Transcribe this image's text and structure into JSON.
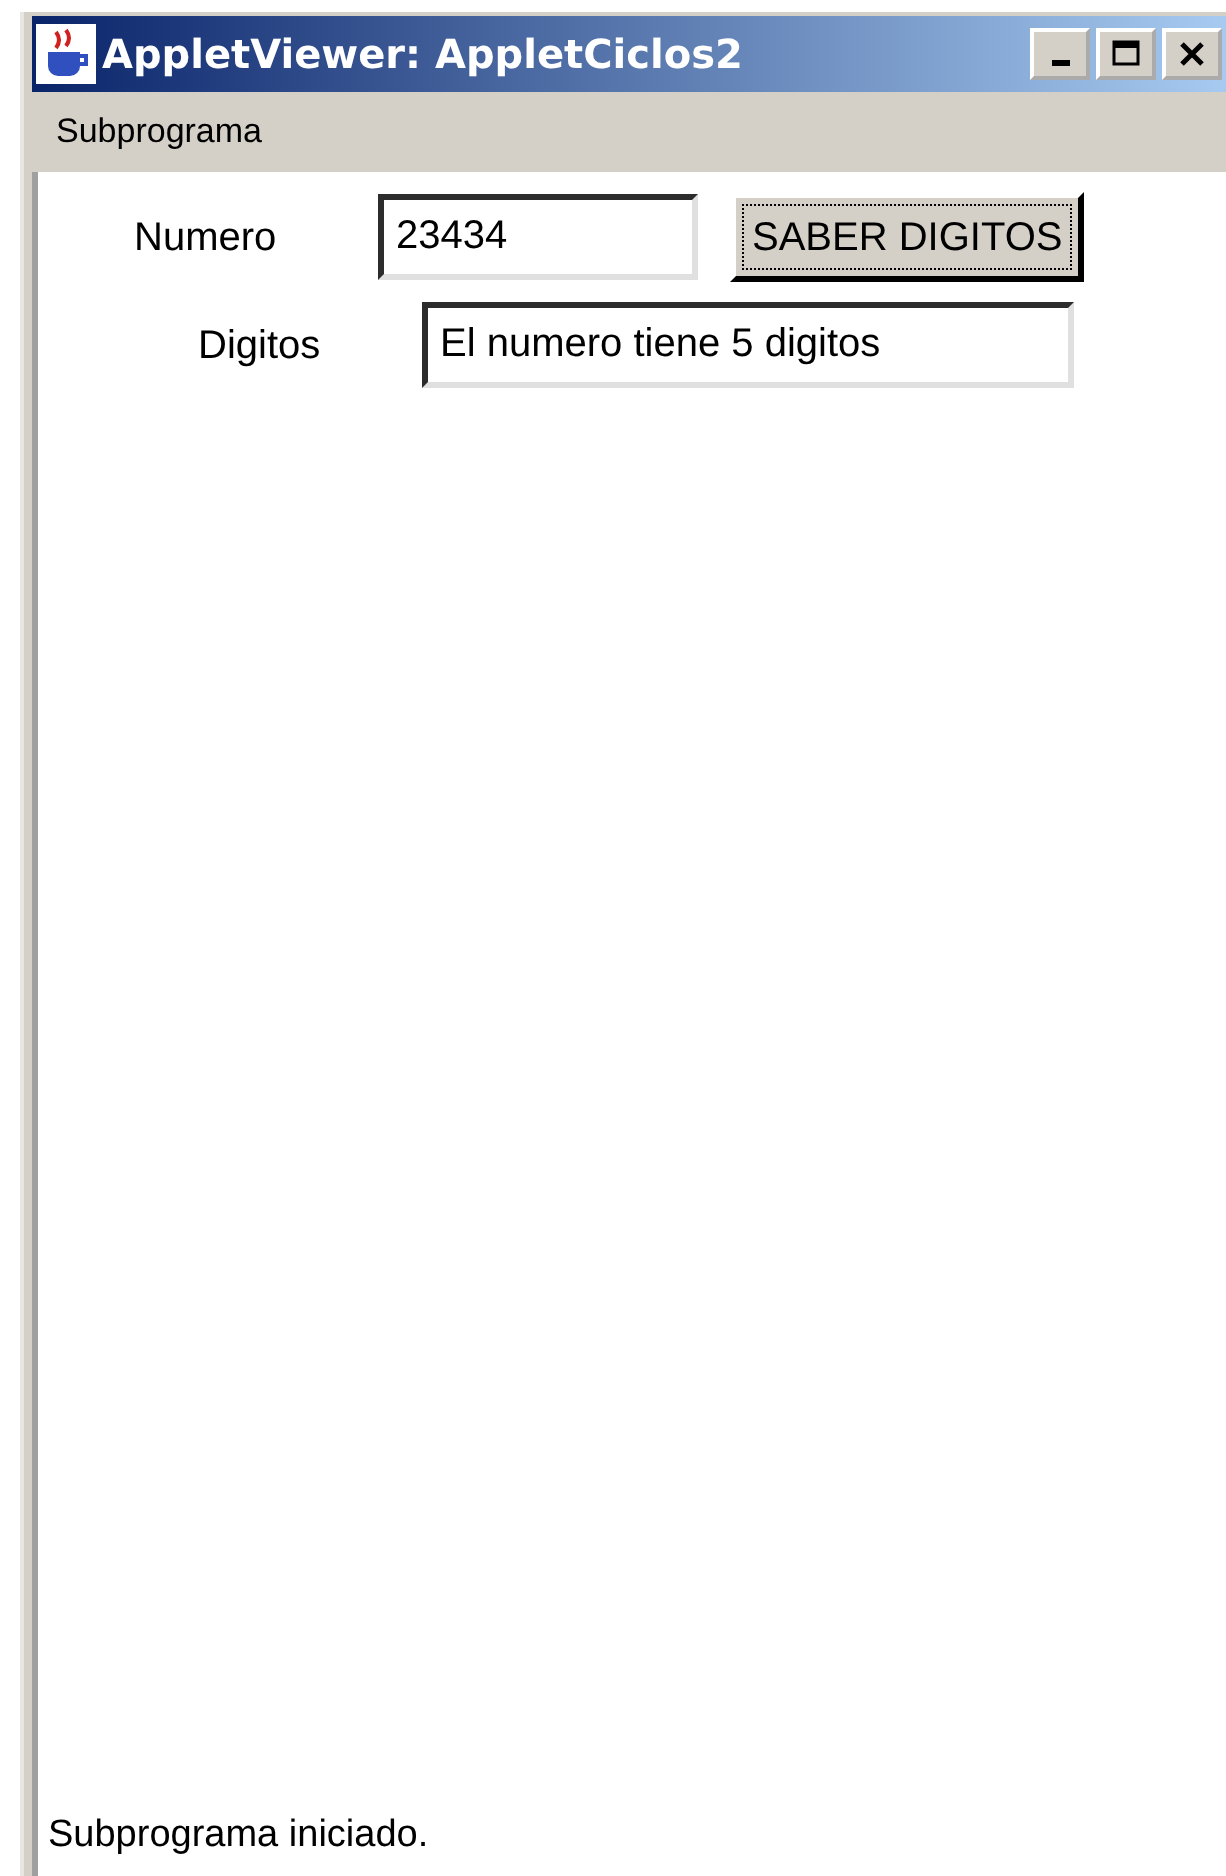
{
  "window": {
    "title": "AppletViewer: AppletCiclos2"
  },
  "menu": [
    "Subprograma"
  ],
  "form": {
    "numero_label": "Numero",
    "numero_value": "23434",
    "button": "SABER DIGITOS",
    "digitos_label": "Digitos",
    "digitos_value": "El numero tiene 5 digitos"
  },
  "status_bar": "Subprograma iniciado."
}
